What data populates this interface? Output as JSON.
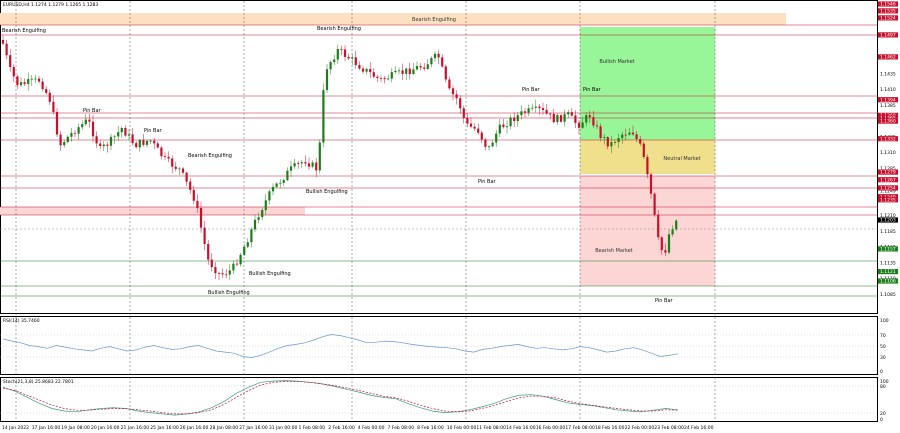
{
  "header": {
    "symbol_line": "EURUSD,H4  1.1274 1.1279 1.1265 1.1283"
  },
  "main_panel": {
    "price_min": 1.106,
    "price_max": 1.1546,
    "price_labels": [
      "1.1546",
      "1.1535",
      "1.1524",
      "1.1497",
      "1.1462",
      "1.1460",
      "1.1435",
      "1.1410",
      "1.1394",
      "1.1385",
      "1.1369",
      "1.1365",
      "1.1360",
      "1.1335",
      "1.1332",
      "1.1310",
      "1.1285",
      "1.1279",
      "1.1267",
      "1.1254",
      "1.1249",
      "1.1240",
      "1.1235",
      "1.1210",
      "1.1203",
      "1.1185",
      "1.1160",
      "1.1157",
      "1.1135",
      "1.1121",
      "1.1110",
      "1.1106",
      "1.1085"
    ],
    "highlight_labels": [
      {
        "value": "1.1546",
        "color": "#c8102e"
      },
      {
        "value": "1.1535",
        "color": "#c8102e"
      },
      {
        "value": "1.1524",
        "color": "#c8102e"
      },
      {
        "value": "1.1497",
        "color": "#c8102e"
      },
      {
        "value": "1.1462",
        "color": "#c8102e"
      },
      {
        "value": "1.1394",
        "color": "#c8102e"
      },
      {
        "value": "1.1369",
        "color": "#c8102e"
      },
      {
        "value": "1.1365",
        "color": "#c8102e"
      },
      {
        "value": "1.1360",
        "color": "#c8102e"
      },
      {
        "value": "1.1332",
        "color": "#c8102e"
      },
      {
        "value": "1.1279",
        "color": "#c8102e"
      },
      {
        "value": "1.1267",
        "color": "#c8102e"
      },
      {
        "value": "1.1254",
        "color": "#c8102e"
      },
      {
        "value": "1.1240",
        "color": "#c8102e"
      },
      {
        "value": "1.1235",
        "color": "#c8102e"
      },
      {
        "value": "1.1203",
        "color": "#000000"
      },
      {
        "value": "1.1157",
        "color": "#1a7f1a"
      },
      {
        "value": "1.1121",
        "color": "#1a7f1a"
      },
      {
        "value": "1.1106",
        "color": "#1a7f1a"
      }
    ],
    "zones": [
      {
        "label": "Bearish Engulfing",
        "color": "#fde0c0"
      },
      {
        "label": "Bullish Market",
        "color": "#98f598"
      },
      {
        "label": "Neutral Market",
        "color": "#f0e08c"
      },
      {
        "label": "Bearish Market",
        "color": "#fbd6d4"
      }
    ],
    "annotations": [
      "Bearish Engulfing",
      "Bearish Engulfing",
      "Pin Bar",
      "Pin Bar",
      "Bearish Engulfing",
      "Bullish Engulfing",
      "Bullish Engulfing",
      "Bullish Engulfing",
      "Pin Bar",
      "Pin Bar",
      "Pin Bar",
      "Pin Bar"
    ]
  },
  "rsi_panel": {
    "label": "RSI(14) 35.7460",
    "levels": [
      "100",
      "70",
      "50",
      "30",
      "0"
    ],
    "values": [
      62,
      58,
      55,
      50,
      48,
      45,
      50,
      47,
      44,
      42,
      40,
      45,
      48,
      44,
      40,
      42,
      47,
      50,
      46,
      43,
      44,
      48,
      50,
      45,
      40,
      38,
      36,
      30,
      28,
      32,
      38,
      45,
      50,
      52,
      55,
      60,
      66,
      70,
      68,
      64,
      60,
      55,
      56,
      58,
      57,
      55,
      52,
      50,
      48,
      47,
      46,
      44,
      40,
      38,
      43,
      45,
      48,
      50,
      52,
      48,
      45,
      46,
      44,
      42,
      44,
      48,
      46,
      42,
      38,
      40,
      44,
      46,
      42,
      36,
      30,
      32,
      35
    ]
  },
  "stoch_panel": {
    "label": "Stoch(21,3,8) 25.8683 22.7801",
    "levels": [
      "100",
      "80",
      "20",
      "0"
    ],
    "main_values": [
      80,
      70,
      55,
      40,
      28,
      22,
      20,
      25,
      28,
      30,
      28,
      22,
      18,
      15,
      12,
      15,
      20,
      30,
      45,
      65,
      80,
      92,
      95,
      96,
      95,
      92,
      88,
      82,
      75,
      68,
      60,
      55,
      52,
      40,
      30,
      22,
      18,
      20,
      25,
      32,
      40,
      52,
      60,
      62,
      58,
      50,
      42,
      38,
      35,
      30,
      25,
      22,
      20,
      24,
      28,
      25
    ],
    "signal_values": [
      78,
      72,
      60,
      48,
      36,
      28,
      24,
      24,
      26,
      28,
      28,
      25,
      22,
      18,
      15,
      15,
      18,
      25,
      38,
      55,
      72,
      85,
      92,
      94,
      94,
      92,
      88,
      84,
      78,
      72,
      65,
      58,
      54,
      46,
      36,
      28,
      22,
      20,
      22,
      28,
      35,
      45,
      54,
      58,
      58,
      54,
      46,
      40,
      36,
      32,
      28,
      25,
      22,
      22,
      25,
      24
    ]
  },
  "time_axis": {
    "labels": [
      "14 Jan 2022",
      "17 Jan 16:00",
      "19 Jan 08:00",
      "20 Jan 16:00",
      "21 Jan 16:00",
      "25 Jan 16:00",
      "26 Jan 16:00",
      "28 Jan 08:00",
      "27 Jan 16:00",
      "31 Jan 00:00",
      "1 Feb 08:00",
      "2 Feb 16:00",
      "4 Feb 00:00",
      "7 Feb 08:00",
      "8 Feb 16:00",
      "10 Feb 00:00",
      "11 Feb 08:00",
      "14 Feb 16:00",
      "16 Feb 00:00",
      "17 Feb 08:00",
      "18 Feb 16:00",
      "22 Feb 00:00",
      "23 Feb 08:00",
      "24 Feb 16:00"
    ]
  },
  "colors": {
    "bull": "#1a7f1a",
    "bear": "#c8102e",
    "rsi_line": "#6699cc",
    "stoch_main": "#3a9a8a",
    "stoch_signal": "#c8102e"
  }
}
